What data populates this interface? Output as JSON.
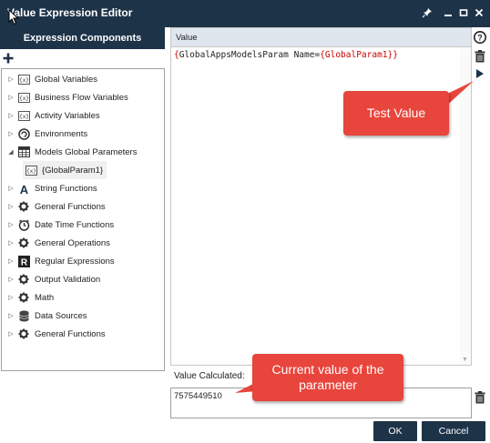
{
  "window": {
    "title": "Value Expression Editor",
    "pin_icon": "pin-icon",
    "minimize_icon": "minimize-icon",
    "maximize_icon": "maximize-icon",
    "close_icon": "close-icon"
  },
  "left": {
    "header": "Expression Components",
    "add_icon": "plus-icon",
    "tree": [
      {
        "label": "Global Variables",
        "icon": "variable-icon",
        "expanded": false
      },
      {
        "label": "Business Flow Variables",
        "icon": "variable-icon",
        "expanded": false
      },
      {
        "label": "Activity Variables",
        "icon": "variable-icon",
        "expanded": false
      },
      {
        "label": "Environments",
        "icon": "environment-icon",
        "expanded": false
      },
      {
        "label": "Models Global Parameters",
        "icon": "table-icon",
        "expanded": true
      },
      {
        "label": "{GlobalParam1}",
        "icon": "variable-icon",
        "child": true
      },
      {
        "label": "String Functions",
        "icon": "string-icon",
        "expanded": false
      },
      {
        "label": "General Functions",
        "icon": "gear-icon",
        "expanded": false
      },
      {
        "label": "Date Time Functions",
        "icon": "clock-icon",
        "expanded": false
      },
      {
        "label": "General Operations",
        "icon": "gear-icon",
        "expanded": false
      },
      {
        "label": "Regular Expressions",
        "icon": "regex-icon",
        "expanded": false
      },
      {
        "label": "Output Validation",
        "icon": "gear-icon",
        "expanded": false
      },
      {
        "label": "Math",
        "icon": "gear-icon",
        "expanded": false
      },
      {
        "label": "Data Sources",
        "icon": "database-icon",
        "expanded": false
      },
      {
        "label": "General Functions",
        "icon": "gear-icon",
        "expanded": false
      }
    ]
  },
  "editor": {
    "header": "Value",
    "expression_open": "{",
    "expression_body": "GlobalAppsModelsParam Name=",
    "expression_inner": "{GlobalParam1}",
    "expression_close": "}",
    "help_icon": "help-icon",
    "clear_icon": "trash-icon",
    "test_icon": "play-icon"
  },
  "value": {
    "label": "Value Calculated:",
    "result": "7575449510",
    "clear_icon": "trash-icon"
  },
  "callouts": {
    "test_value": "Test Value",
    "current_value": "Current value of the parameter"
  },
  "buttons": {
    "ok": "OK",
    "cancel": "Cancel"
  },
  "colors": {
    "titlebar": "#1d3348",
    "callout": "#e8453c",
    "brace": "#cc0000"
  }
}
